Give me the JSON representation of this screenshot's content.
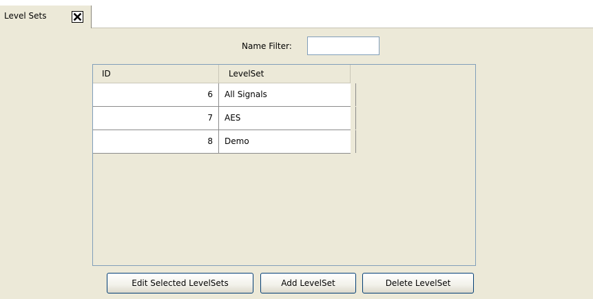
{
  "tab": {
    "label": "Level Sets",
    "close_icon": "close-icon"
  },
  "filter": {
    "label": "Name Filter:",
    "value": "",
    "placeholder": ""
  },
  "table": {
    "columns": [
      "ID",
      "LevelSet"
    ],
    "rows": [
      {
        "id": "6",
        "levelset": "All Signals"
      },
      {
        "id": "7",
        "levelset": "AES"
      },
      {
        "id": "8",
        "levelset": "Demo"
      }
    ]
  },
  "buttons": {
    "edit_label": "Edit Selected LevelSets",
    "add_label": "Add LevelSet",
    "delete_label": "Delete LevelSet"
  },
  "colors": {
    "panel_background": "#ece9d8",
    "table_border": "#7f9db9",
    "button_border": "#003c74"
  }
}
